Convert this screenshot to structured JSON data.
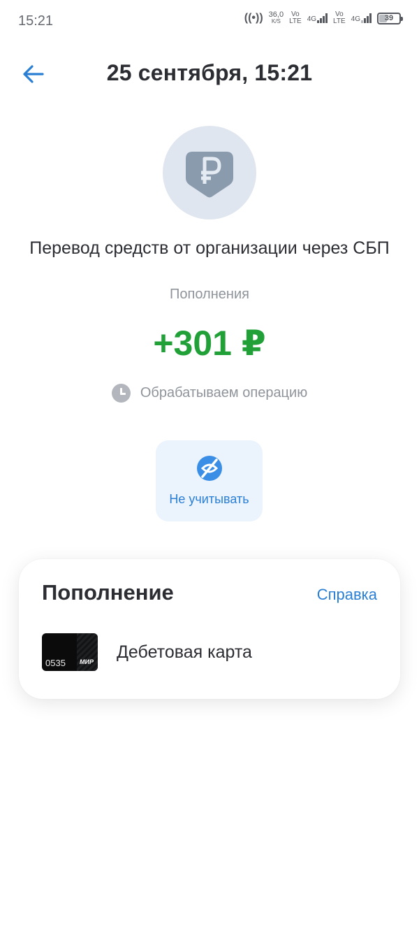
{
  "status_bar": {
    "time": "15:21",
    "speed_value": "36,0",
    "speed_unit": "K/S",
    "volte_1": "Vo",
    "lte_1": "LTE",
    "net_1": "4G",
    "volte_2": "Vo",
    "lte_2": "LTE",
    "net_2": "4G",
    "battery": "39"
  },
  "header": {
    "title": "25 сентября, 15:21"
  },
  "operation": {
    "title": "Перевод средств от организации через СБП",
    "category": "Пополнения",
    "amount": "+301 ₽",
    "status": "Обрабатываем операцию",
    "amount_color": "#21a038"
  },
  "actions": {
    "ignore_label": "Не учитывать"
  },
  "details_card": {
    "title": "Пополнение",
    "help_label": "Справка",
    "account": {
      "card_last_digits": "0535",
      "card_brand": "МИР",
      "label": "Дебетовая карта"
    }
  },
  "colors": {
    "accent": "#2a7fd4",
    "positive": "#21a038",
    "muted": "#8f949b"
  }
}
